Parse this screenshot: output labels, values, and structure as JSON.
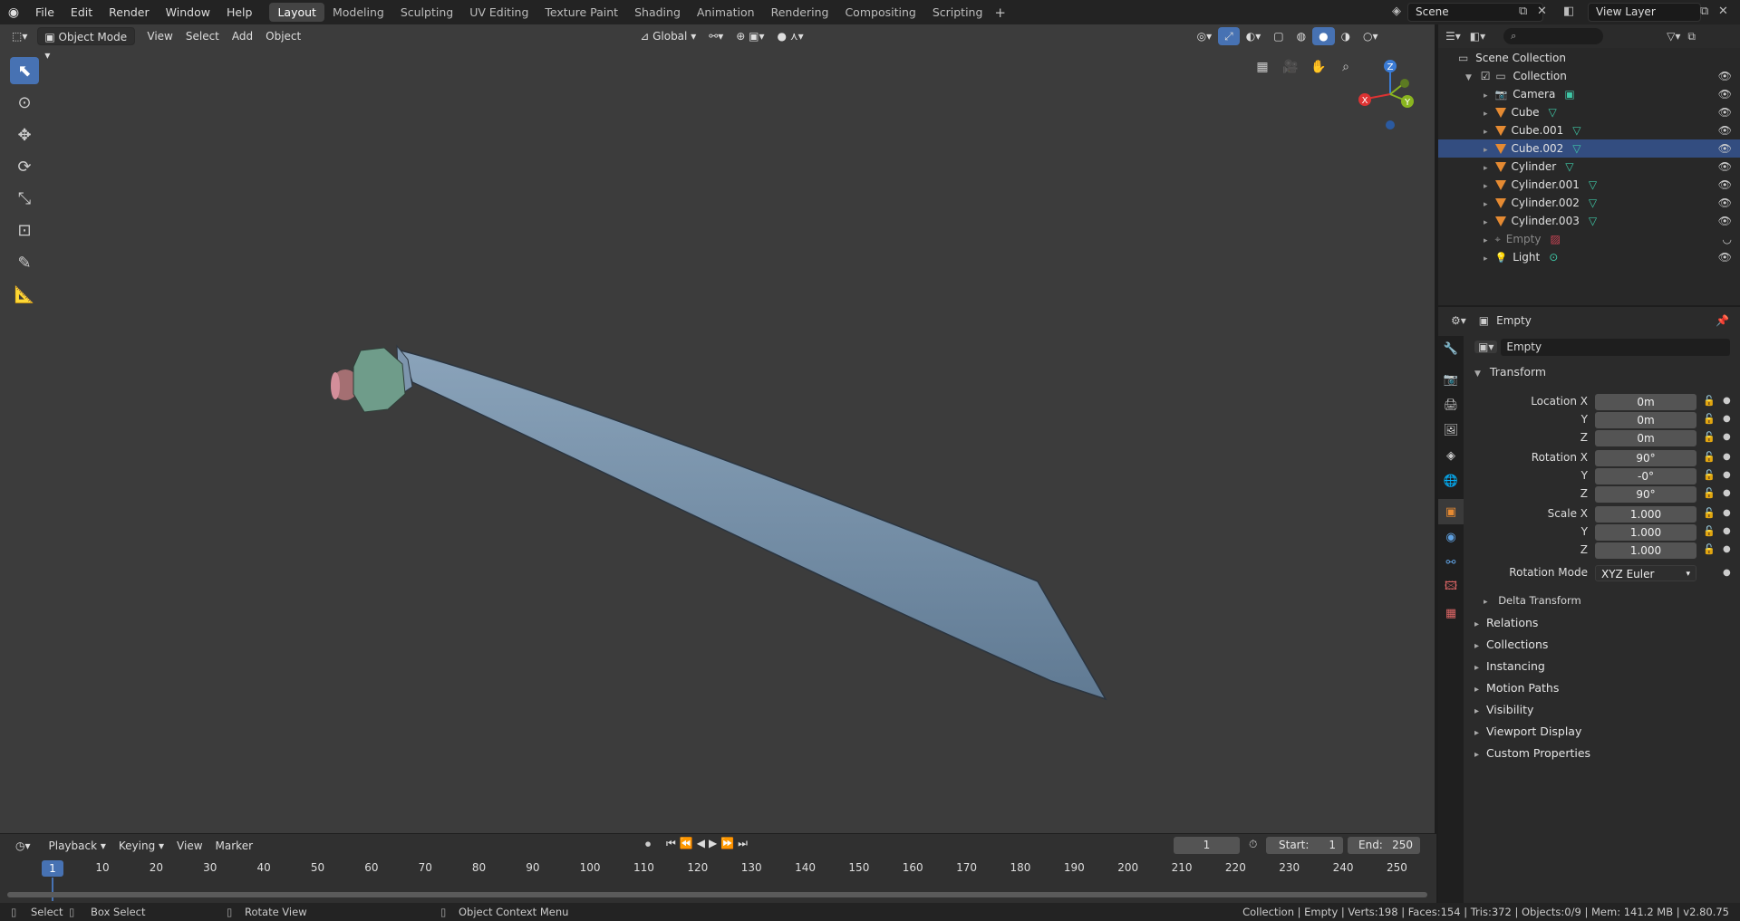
{
  "menu": [
    "File",
    "Edit",
    "Render",
    "Window",
    "Help"
  ],
  "workspaces": [
    "Layout",
    "Modeling",
    "Sculpting",
    "UV Editing",
    "Texture Paint",
    "Shading",
    "Animation",
    "Rendering",
    "Compositing",
    "Scripting"
  ],
  "scene_name": "Scene",
  "view_layer": "View Layer",
  "viewport": {
    "mode": "Object Mode",
    "menus": [
      "View",
      "Select",
      "Add",
      "Object"
    ],
    "orientation": "Global",
    "gizmo_axes": {
      "z": "Z",
      "x": "X",
      "y": "Y"
    }
  },
  "outliner": {
    "search_placeholder": "",
    "scene_collection": "Scene Collection",
    "collection": "Collection",
    "items": [
      {
        "name": "Camera",
        "type": "camera"
      },
      {
        "name": "Cube",
        "type": "mesh"
      },
      {
        "name": "Cube.001",
        "type": "mesh"
      },
      {
        "name": "Cube.002",
        "type": "mesh",
        "selected": true
      },
      {
        "name": "Cylinder",
        "type": "mesh"
      },
      {
        "name": "Cylinder.001",
        "type": "mesh"
      },
      {
        "name": "Cylinder.002",
        "type": "mesh"
      },
      {
        "name": "Cylinder.003",
        "type": "mesh"
      },
      {
        "name": "Empty",
        "type": "empty",
        "hidden": true
      },
      {
        "name": "Light",
        "type": "light"
      }
    ]
  },
  "properties": {
    "object_context": "Empty",
    "object_name": "Empty",
    "transform_header": "Transform",
    "location": {
      "label_x": "Location X",
      "label_y": "Y",
      "label_z": "Z",
      "x": "0m",
      "y": "0m",
      "z": "0m"
    },
    "rotation": {
      "label_x": "Rotation X",
      "label_y": "Y",
      "label_z": "Z",
      "x": "90°",
      "y": "-0°",
      "z": "90°"
    },
    "scale": {
      "label_x": "Scale X",
      "label_y": "Y",
      "label_z": "Z",
      "x": "1.000",
      "y": "1.000",
      "z": "1.000"
    },
    "rotation_mode_label": "Rotation Mode",
    "rotation_mode": "XYZ Euler",
    "delta_transform": "Delta Transform",
    "panels": [
      "Relations",
      "Collections",
      "Instancing",
      "Motion Paths",
      "Visibility",
      "Viewport Display",
      "Custom Properties"
    ]
  },
  "timeline": {
    "menus": [
      "Playback",
      "Keying",
      "View",
      "Marker"
    ],
    "current_frame": "1",
    "start_label": "Start:",
    "start": "1",
    "end_label": "End:",
    "end": "250",
    "ticks": [
      "10",
      "20",
      "30",
      "40",
      "50",
      "60",
      "70",
      "80",
      "90",
      "100",
      "110",
      "120",
      "130",
      "140",
      "150",
      "160",
      "170",
      "180",
      "190",
      "200",
      "210",
      "220",
      "230",
      "240",
      "250"
    ]
  },
  "statusbar": {
    "select": "Select",
    "box_select": "Box Select",
    "rotate_view": "Rotate View",
    "context_menu": "Object Context Menu",
    "stats": "Collection | Empty | Verts:198 | Faces:154 | Tris:372 | Objects:0/9 | Mem: 141.2 MB | v2.80.75"
  },
  "colors": {
    "accent": "#4772b3",
    "selected_row": "#334d80",
    "mesh_icon": "#e58a32",
    "blade": "#7a93ab",
    "guard": "#6f9c8a",
    "pommel": "#a87070"
  }
}
